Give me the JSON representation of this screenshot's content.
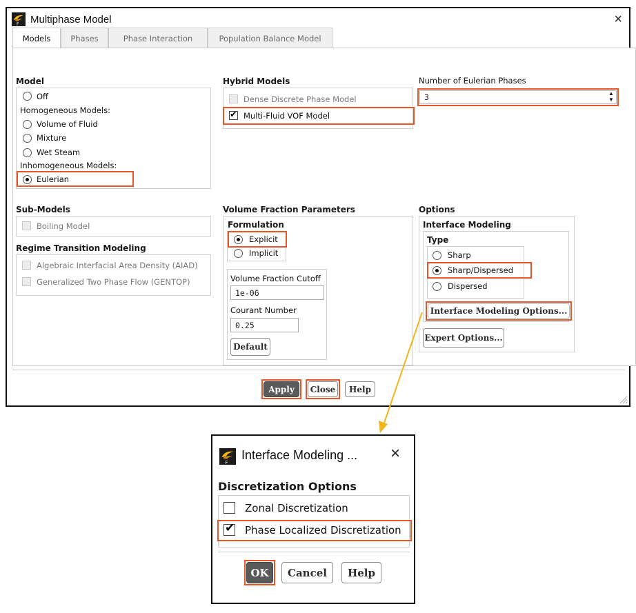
{
  "main_dialog": {
    "title": "Multiphase Model",
    "close_glyph": "×",
    "app_icon": "fluent-app-icon",
    "tabs": [
      {
        "label": "Models",
        "active": true
      },
      {
        "label": "Phases",
        "active": false
      },
      {
        "label": "Phase Interaction",
        "active": false
      },
      {
        "label": "Population Balance Model",
        "active": false
      }
    ],
    "model": {
      "header": "Model",
      "off": "Off",
      "homogeneous_label": "Homogeneous Models:",
      "vof": "Volume of Fluid",
      "mixture": "Mixture",
      "wet_steam": "Wet Steam",
      "inhomogeneous_label": "Inhomogeneous Models:",
      "eulerian": "Eulerian",
      "selected": "Eulerian"
    },
    "hybrid": {
      "header": "Hybrid Models",
      "dense_discrete": "Dense Discrete Phase Model",
      "multi_fluid_vof": "Multi-Fluid VOF Model",
      "multi_fluid_vof_checked": true,
      "dense_discrete_checked": false
    },
    "eulerian_phases": {
      "label": "Number of Eulerian Phases",
      "value": "3"
    },
    "sub_models": {
      "header": "Sub-Models",
      "boiling": "Boiling Model"
    },
    "regime": {
      "header": "Regime Transition Modeling",
      "aiad": "Algebraic Interfacial Area Density (AIAD)",
      "gentop": "Generalized Two Phase Flow (GENTOP)"
    },
    "volume_fraction": {
      "header": "Volume Fraction Parameters",
      "formulation_header": "Formulation",
      "explicit": "Explicit",
      "implicit": "Implicit",
      "selected": "Explicit",
      "cutoff_label": "Volume Fraction Cutoff",
      "cutoff_value": "1e-06",
      "courant_label": "Courant Number",
      "courant_value": "0.25",
      "default_button": "Default"
    },
    "options": {
      "header": "Options",
      "interface_header": "Interface Modeling",
      "type_header": "Type",
      "sharp": "Sharp",
      "sharp_dispersed": "Sharp/Dispersed",
      "dispersed": "Dispersed",
      "selected": "Sharp/Dispersed",
      "interface_options_button": "Interface Modeling Options...",
      "expert_button": "Expert Options..."
    },
    "buttons": {
      "apply": "Apply",
      "close": "Close",
      "help": "Help"
    }
  },
  "sub_dialog": {
    "title": "Interface Modeling ...",
    "close_glyph": "×",
    "app_icon": "fluent-app-icon",
    "header": "Discretization Options",
    "zonal": "Zonal Discretization",
    "zonal_checked": false,
    "phase_localized": "Phase Localized Discretization",
    "phase_localized_checked": true,
    "buttons": {
      "ok": "OK",
      "cancel": "Cancel",
      "help": "Help"
    }
  },
  "colors": {
    "highlight": "#e8552b",
    "arrow": "#f2b51c",
    "primary_button": "#5a5a5a"
  }
}
